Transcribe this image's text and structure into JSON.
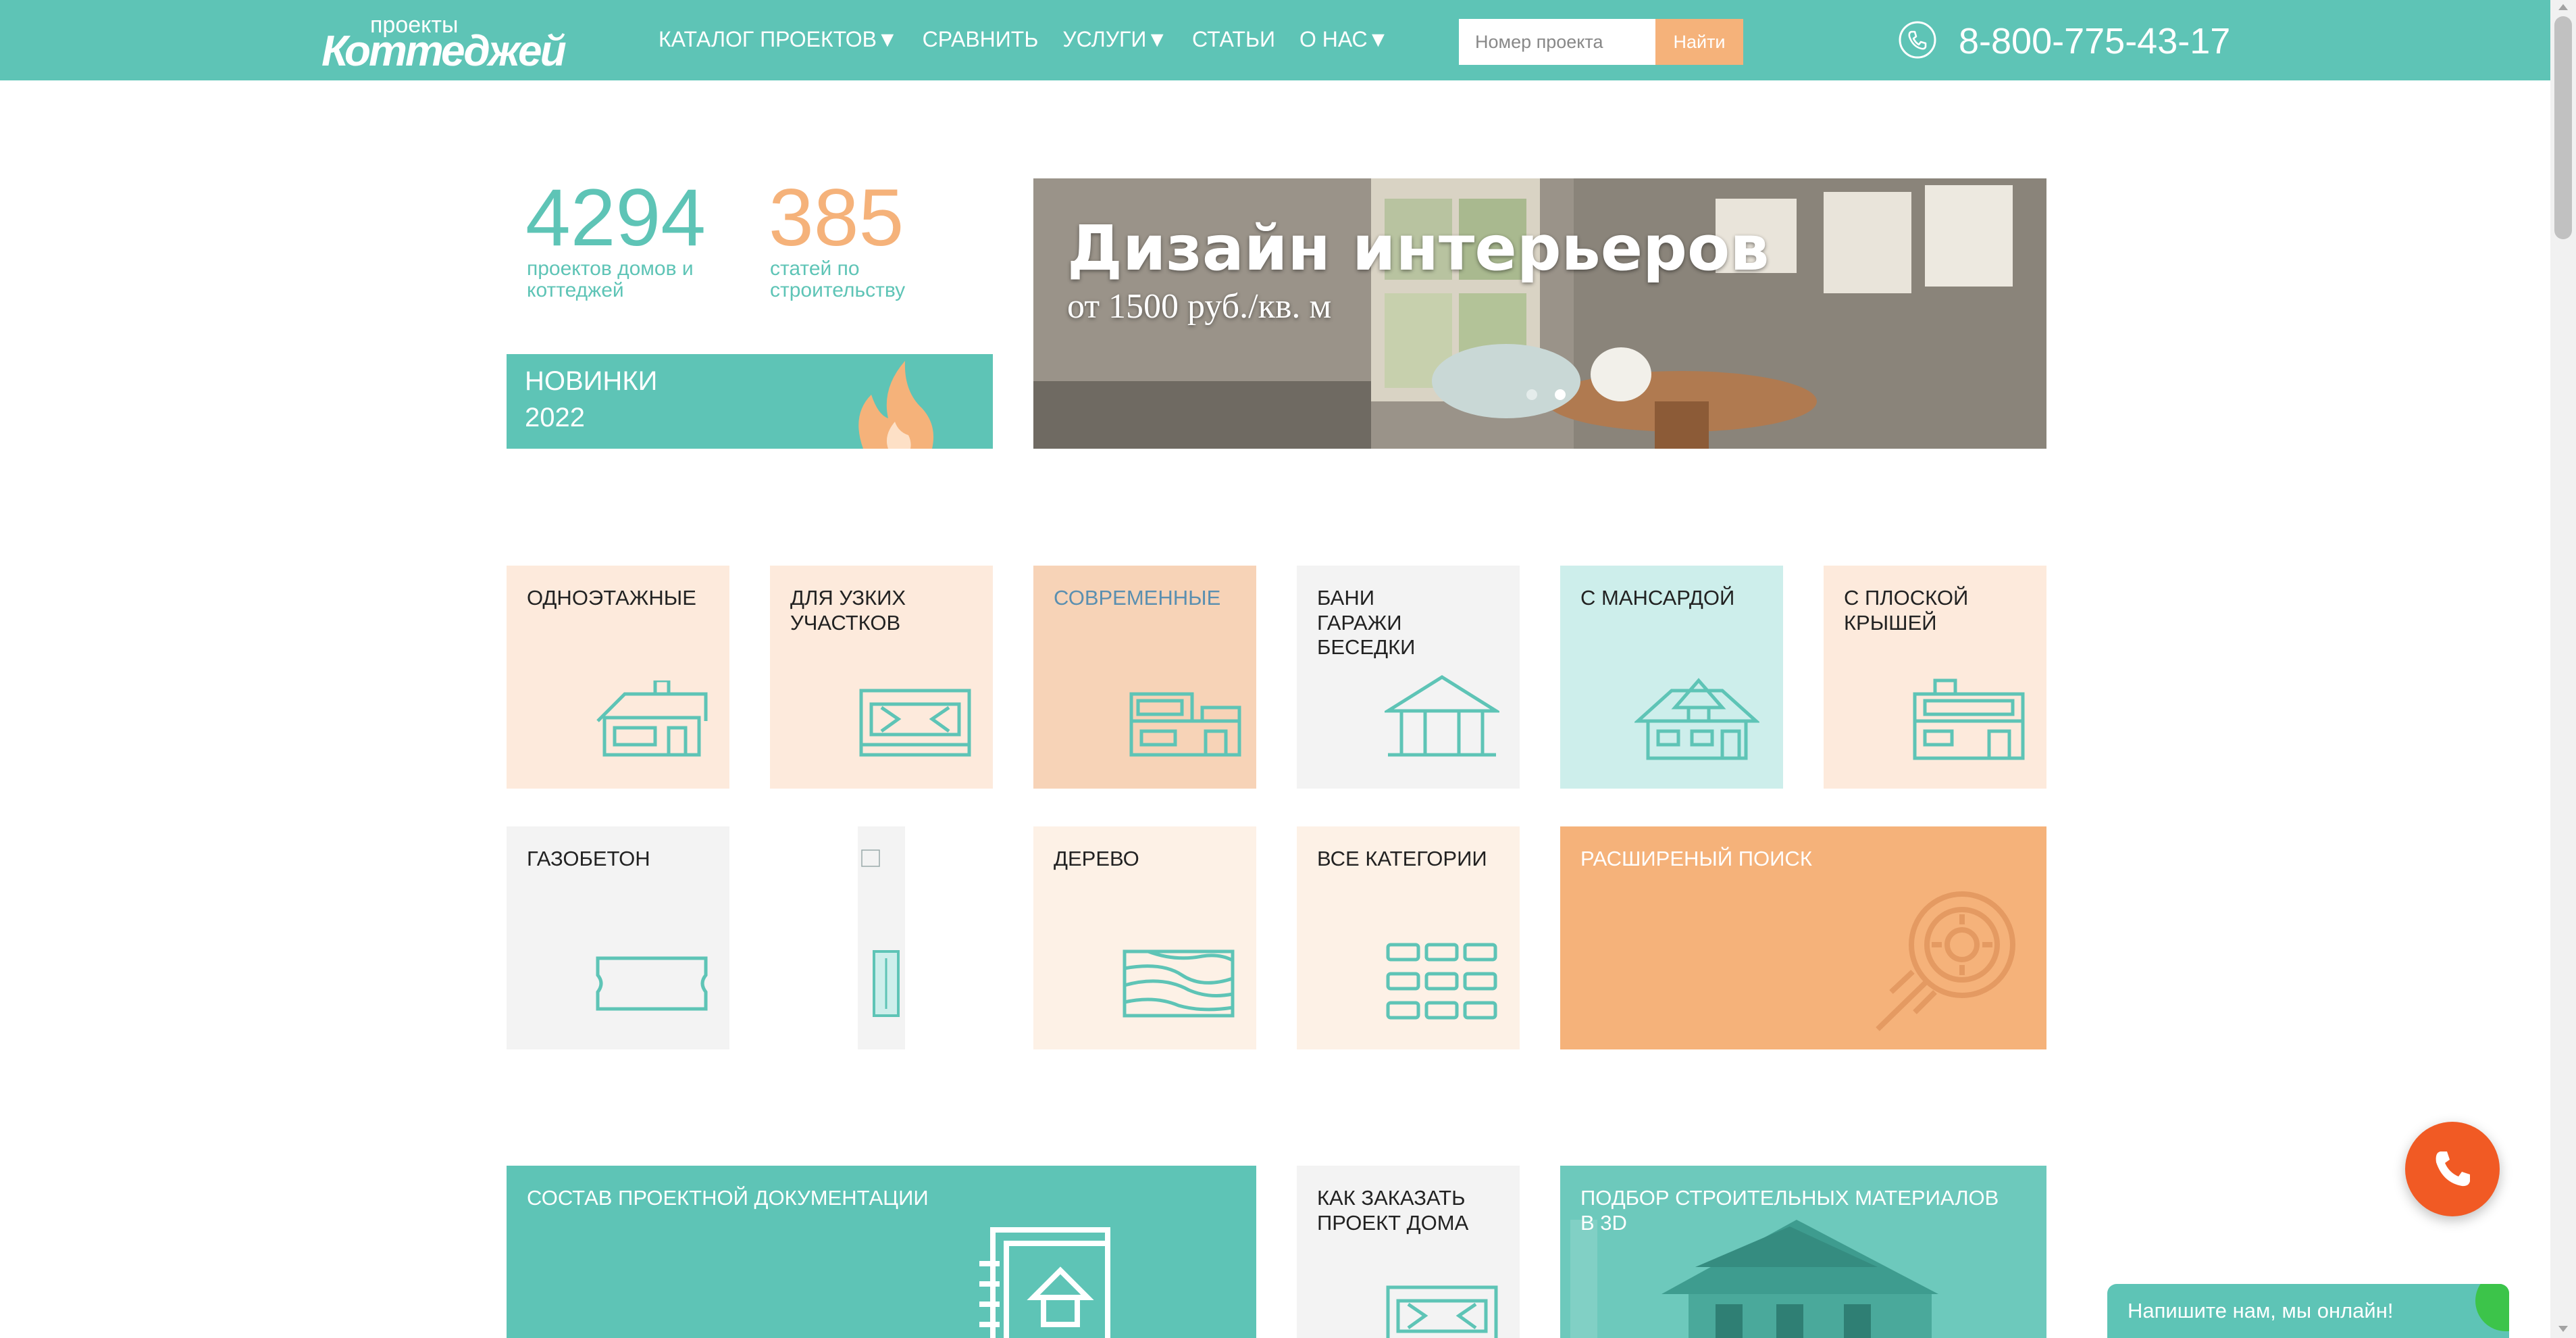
{
  "header": {
    "logo_small": "проекты",
    "logo_big": "Коттеджей",
    "nav": [
      {
        "label": "КАТАЛОГ ПРОЕКТОВ▼"
      },
      {
        "label": "СРАВНИТЬ"
      },
      {
        "label": "УСЛУГИ▼"
      },
      {
        "label": "СТАТЬИ"
      },
      {
        "label": "О НАС▼"
      }
    ],
    "search_placeholder": "Номер проекта",
    "search_button": "Найти",
    "phone": "8-800-775-43-17"
  },
  "stats": {
    "projects_count": "4294",
    "projects_label": "проектов домов и\nкоттеджей",
    "articles_count": "385",
    "articles_label": "статей по\nстроительству"
  },
  "novinki": {
    "title": "НОВИНКИ",
    "year": "2022"
  },
  "banner": {
    "title": "Дизайн интерьеров",
    "subtitle": "от 1500 руб./кв. м"
  },
  "tiles_row1": [
    {
      "label": "ОДНОЭТАЖНЫЕ",
      "icon": "one-story-house-icon"
    },
    {
      "label": "ДЛЯ УЗКИХ\nУЧАСТКОВ",
      "icon": "narrow-plot-icon"
    },
    {
      "label": "СОВРЕМЕННЫЕ",
      "icon": "modern-house-icon"
    },
    {
      "label": "БАНИ\nГАРАЖИ\nБЕСЕДКИ",
      "icon": "gazebo-icon"
    },
    {
      "label": "С МАНСАРДОЙ",
      "icon": "attic-house-icon"
    },
    {
      "label": "С ПЛОСКОЙ\nКРЫШЕЙ",
      "icon": "flat-roof-icon"
    }
  ],
  "tiles_row2": [
    {
      "label": "ГАЗОБЕТОН",
      "icon": "aerated-block-icon"
    },
    {
      "label": "ДЕРЕВО",
      "icon": "wood-icon"
    },
    {
      "label": "ВСЕ КАТЕГОРИИ",
      "icon": "grid-icon"
    },
    {
      "label": "РАСШИРЕНЫЙ ПОИСК",
      "icon": "advanced-search-icon"
    }
  ],
  "tiles_row3": [
    {
      "label": "СОСТАВ ПРОЕКТНОЙ ДОКУМЕНТАЦИИ",
      "icon": "documentation-icon"
    },
    {
      "label": "КАК ЗАКАЗАТЬ\nПРОЕКТ ДОМА",
      "icon": "order-icon"
    },
    {
      "label": "ПОДБОР СТРОИТЕЛЬНЫХ МАТЕРИАЛОВ\nВ 3D",
      "icon": "house-3d-icon"
    }
  ],
  "chat": {
    "text": "Напишите нам, мы онлайн!"
  },
  "colors": {
    "teal": "#5ec4b6",
    "orange": "#f5b27a",
    "call": "#f15a24"
  }
}
